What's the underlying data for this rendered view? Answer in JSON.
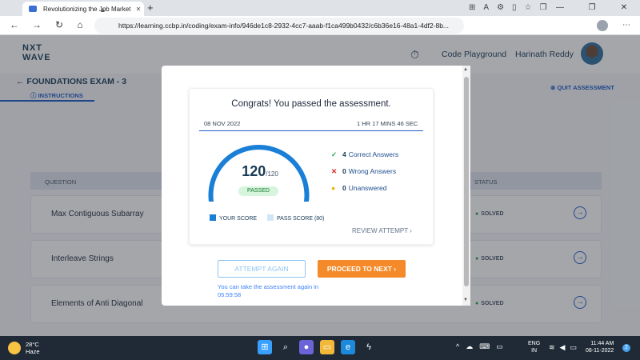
{
  "browser": {
    "tab_title": "Revolutionizing the Job Market |",
    "tab_close": "✕",
    "new_tab": "+",
    "url": "https://learning.ccbp.in/coding/exam-info/946de1c8-2932-4cc7-aaab-f1ca499b0432/c6b36e16-48a1-4df2-8b..."
  },
  "header": {
    "logo_line1": "NXT",
    "logo_line2": "WAVE",
    "code_playground": "Code Playground",
    "username": "Harinath Reddy"
  },
  "exam": {
    "title": "FOUNDATIONS EXAM - 3",
    "instructions": "INSTRUCTIONS",
    "quit": "QUIT ASSESSMENT",
    "col_question": "QUESTION",
    "col_status": "STATUS",
    "rows": [
      {
        "question": "Max Contiguous Subarray",
        "status": "SOLVED"
      },
      {
        "question": "Interleave Strings",
        "status": "SOLVED"
      },
      {
        "question": "Elements of Anti Diagonal",
        "status": "SOLVED"
      }
    ]
  },
  "modal": {
    "heading": "Congrats! You passed the assessment.",
    "date": "08 NOV 2022",
    "duration": "1 HR 17 MINS 46 SEC",
    "score": "120",
    "max_score": "/120",
    "score_fraction": 1.0,
    "pass_fraction": 0.667,
    "status_badge": "PASSED",
    "stats": [
      {
        "count": "4",
        "label": "Correct Answers",
        "icon": "check-icon",
        "color": "#16a34a"
      },
      {
        "count": "0",
        "label": "Wrong Answers",
        "icon": "cross-icon",
        "color": "#dc2626"
      },
      {
        "count": "0",
        "label": "Unanswered",
        "icon": "dot-icon",
        "color": "#eab308"
      }
    ],
    "legend_your_score": "YOUR SCORE",
    "legend_pass_score": "PASS SCORE (80)",
    "review": "REVIEW ATTEMPT",
    "attempt_again": "ATTEMPT AGAIN",
    "proceed": "PROCEED TO NEXT",
    "hint": "You can take the assessment again in 05:59:58"
  },
  "colors": {
    "accent": "#1c5cc7",
    "gauge_fill": "#1a7fd6",
    "proceed": "#f58a2a"
  },
  "taskbar": {
    "temp": "28°C",
    "weather": "Haze",
    "lang1": "ENG",
    "lang2": "IN",
    "time": "11:44 AM",
    "date": "08-11-2022",
    "notifications": "2"
  }
}
